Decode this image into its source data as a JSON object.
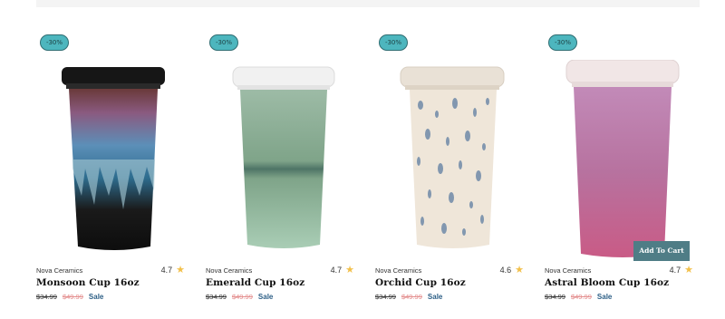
{
  "badge_color": "#4db6be",
  "products": [
    {
      "badge": "-30%",
      "brand": "Nova Ceramics",
      "name": "Monsoon Cup 16oz",
      "rating": "4.7",
      "price": "$34.99",
      "old_price": "$49.99",
      "sale_label": "Sale",
      "image": "monsoon-cup"
    },
    {
      "badge": "-30%",
      "brand": "Nova Ceramics",
      "name": "Emerald Cup 16oz",
      "rating": "4.7",
      "price": "$34.99",
      "old_price": "$49.99",
      "sale_label": "Sale",
      "image": "emerald-cup"
    },
    {
      "badge": "-30%",
      "brand": "Nova Ceramics",
      "name": "Orchid Cup 16oz",
      "rating": "4.6",
      "price": "$34.99",
      "old_price": "$49.99",
      "sale_label": "Sale",
      "image": "orchid-cup"
    },
    {
      "badge": "-30%",
      "brand": "Nova Ceramics",
      "name": "Astral Bloom Cup 16oz",
      "rating": "4.7",
      "price": "$34.99",
      "old_price": "$49.99",
      "sale_label": "Sale",
      "image": "astral-bloom-cup",
      "add_to_cart": "Add To Cart"
    }
  ]
}
